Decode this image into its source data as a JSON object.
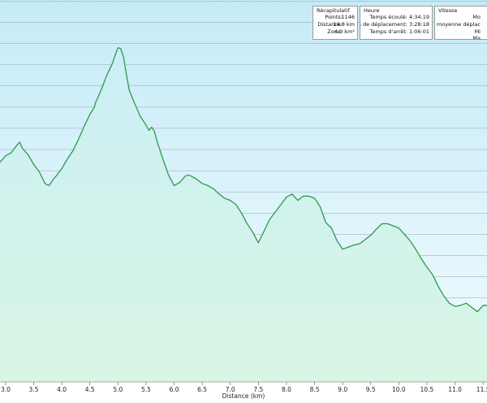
{
  "summary": {
    "title": "Récapitulatif",
    "rows": [
      {
        "label": "Points:",
        "value": "1146"
      },
      {
        "label": "Distance:",
        "value": "14.8 km"
      },
      {
        "label": "Zone:",
        "value": "4.0 km²"
      }
    ]
  },
  "time": {
    "title": "Heure",
    "rows": [
      {
        "label": "Temps écoulé:",
        "value": "4:34:19"
      },
      {
        "label": "Temps de déplacement:",
        "value": "3:28:18"
      },
      {
        "label": "Temps d'arrêt:",
        "value": "1:06:01"
      }
    ]
  },
  "speed": {
    "title": "Vitesse",
    "rows": [
      {
        "label": "Mo"
      },
      {
        "label": "Vitesse moyenne déplac"
      },
      {
        "label": "Mi"
      },
      {
        "label": "Ma"
      }
    ]
  },
  "colors": {
    "line": "#2e9a4a",
    "fill_top": "#cceef6",
    "fill_bottom": "#d8f6e4",
    "bg_top": "#c4ebf7",
    "bg_bottom": "#f2fbff",
    "grid": "#9aa3a8"
  },
  "chart_data": {
    "type": "area",
    "title": "",
    "xlabel": "Distance (km)",
    "ylabel": "",
    "xlim": [
      2.9,
      11.57
    ],
    "ylim": [
      0,
      18
    ],
    "grid": true,
    "x_ticks": [
      "3.0",
      "3.5",
      "4.0",
      "4.5",
      "5.0",
      "5.5",
      "6.0",
      "6.5",
      "7.0",
      "7.5",
      "8.0",
      "8.5",
      "9.0",
      "9.5",
      "10.0",
      "10.5",
      "11.0",
      "11.5"
    ],
    "series": [
      {
        "x": [
          2.9,
          3.0,
          3.1,
          3.2,
          3.25,
          3.3,
          3.4,
          3.5,
          3.6,
          3.7,
          3.77,
          3.8,
          3.85,
          3.9,
          4.0,
          4.1,
          4.2,
          4.3,
          4.4,
          4.5,
          4.58,
          4.6,
          4.7,
          4.8,
          4.9,
          4.95,
          5.0,
          5.05,
          5.1,
          5.15,
          5.2,
          5.3,
          5.4,
          5.45,
          5.5,
          5.55,
          5.6,
          5.65,
          5.7,
          5.8,
          5.9,
          6.0,
          6.1,
          6.2,
          6.25,
          6.3,
          6.4,
          6.5,
          6.6,
          6.7,
          6.8,
          6.9,
          7.0,
          7.1,
          7.2,
          7.3,
          7.4,
          7.5,
          7.6,
          7.7,
          7.8,
          7.9,
          8.0,
          8.1,
          8.2,
          8.3,
          8.4,
          8.5,
          8.6,
          8.7,
          8.8,
          8.9,
          9.0,
          9.1,
          9.2,
          9.3,
          9.4,
          9.5,
          9.6,
          9.7,
          9.8,
          9.9,
          10.0,
          10.1,
          10.2,
          10.3,
          10.4,
          10.5,
          10.6,
          10.7,
          10.8,
          10.9,
          11.0,
          11.1,
          11.2,
          11.3,
          11.4,
          11.5,
          11.57
        ],
        "y": [
          10.8,
          11.4,
          11.7,
          12.4,
          12.7,
          12.1,
          11.5,
          10.6,
          9.9,
          8.8,
          8.6,
          8.8,
          9.2,
          9.5,
          10.2,
          11.1,
          11.9,
          13.0,
          14.2,
          15.3,
          16.0,
          16.4,
          17.6,
          19.0,
          20.1,
          20.9,
          21.6,
          21.5,
          20.7,
          19.1,
          17.6,
          16.3,
          15.1,
          14.7,
          14.3,
          13.8,
          14.1,
          13.7,
          12.7,
          11.1,
          9.6,
          8.6,
          8.9,
          9.5,
          9.6,
          9.5,
          9.2,
          8.8,
          8.6,
          8.3,
          7.8,
          7.4,
          7.2,
          6.8,
          6.0,
          5.0,
          4.2,
          3.2,
          4.3,
          5.4,
          6.1,
          6.8,
          7.5,
          7.8,
          7.2,
          7.6,
          7.6,
          7.4,
          6.6,
          5.1,
          4.6,
          3.4,
          2.6,
          2.8,
          3.0,
          3.1,
          3.5,
          3.9,
          4.5,
          5.0,
          5.0,
          4.8,
          4.6,
          4.0,
          3.4,
          2.6,
          1.7,
          0.9,
          0.2,
          -0.9,
          -1.8,
          -2.5,
          -2.8,
          -2.7,
          -2.5,
          -2.9,
          -3.3,
          -2.7,
          -2.7
        ]
      }
    ]
  }
}
